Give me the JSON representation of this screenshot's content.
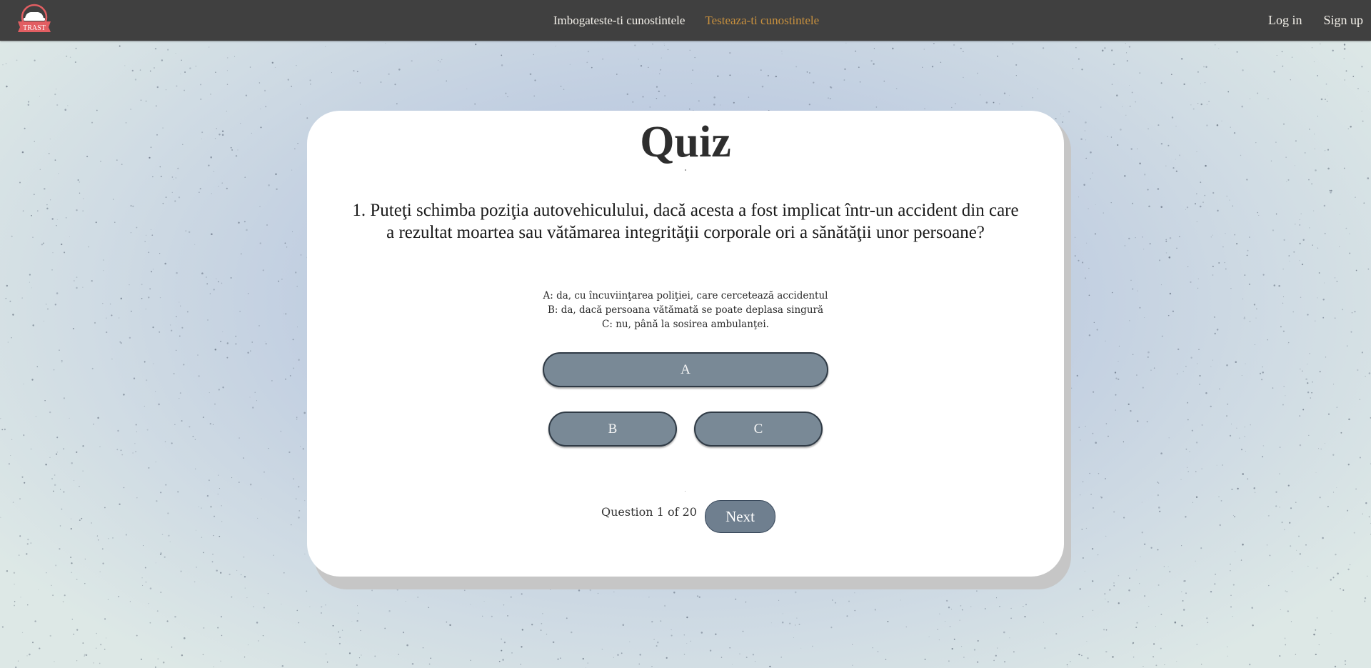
{
  "nav": {
    "logo_text": "TRAST",
    "links": [
      {
        "label": "Imbogateste-ti cunostintele",
        "active": false
      },
      {
        "label": "Testeaza-ti cunostintele",
        "active": true
      }
    ],
    "auth": {
      "login_label": "Log in",
      "signup_label": "Sign up"
    }
  },
  "quiz": {
    "title": "Quiz",
    "question_number": 1,
    "question_text": "1. Puteţi schimba poziţia autovehiculului, dacă acesta a fost implicat într-un accident din care a rezultat moartea sau vătămarea integrităţii corporale ori a sănătăţii unor persoane?",
    "options": [
      "A: da, cu încuviinţarea poliţiei, care cercetează accidentul",
      "B: da, dacă persoana vătămată se poate deplasa singură",
      "C: nu, până la sosirea ambulanţei."
    ],
    "answer_buttons": {
      "a": "A",
      "b": "B",
      "c": "C"
    },
    "progress": {
      "prefix": "Question",
      "current": "1",
      "of": "of",
      "total": "20"
    },
    "next_label": "Next"
  },
  "colors": {
    "navbar": "#404040",
    "nav_active": "#c9913e",
    "answer_button": "#798996",
    "next_button": "#6f7f8f",
    "card": "#ffffff"
  }
}
